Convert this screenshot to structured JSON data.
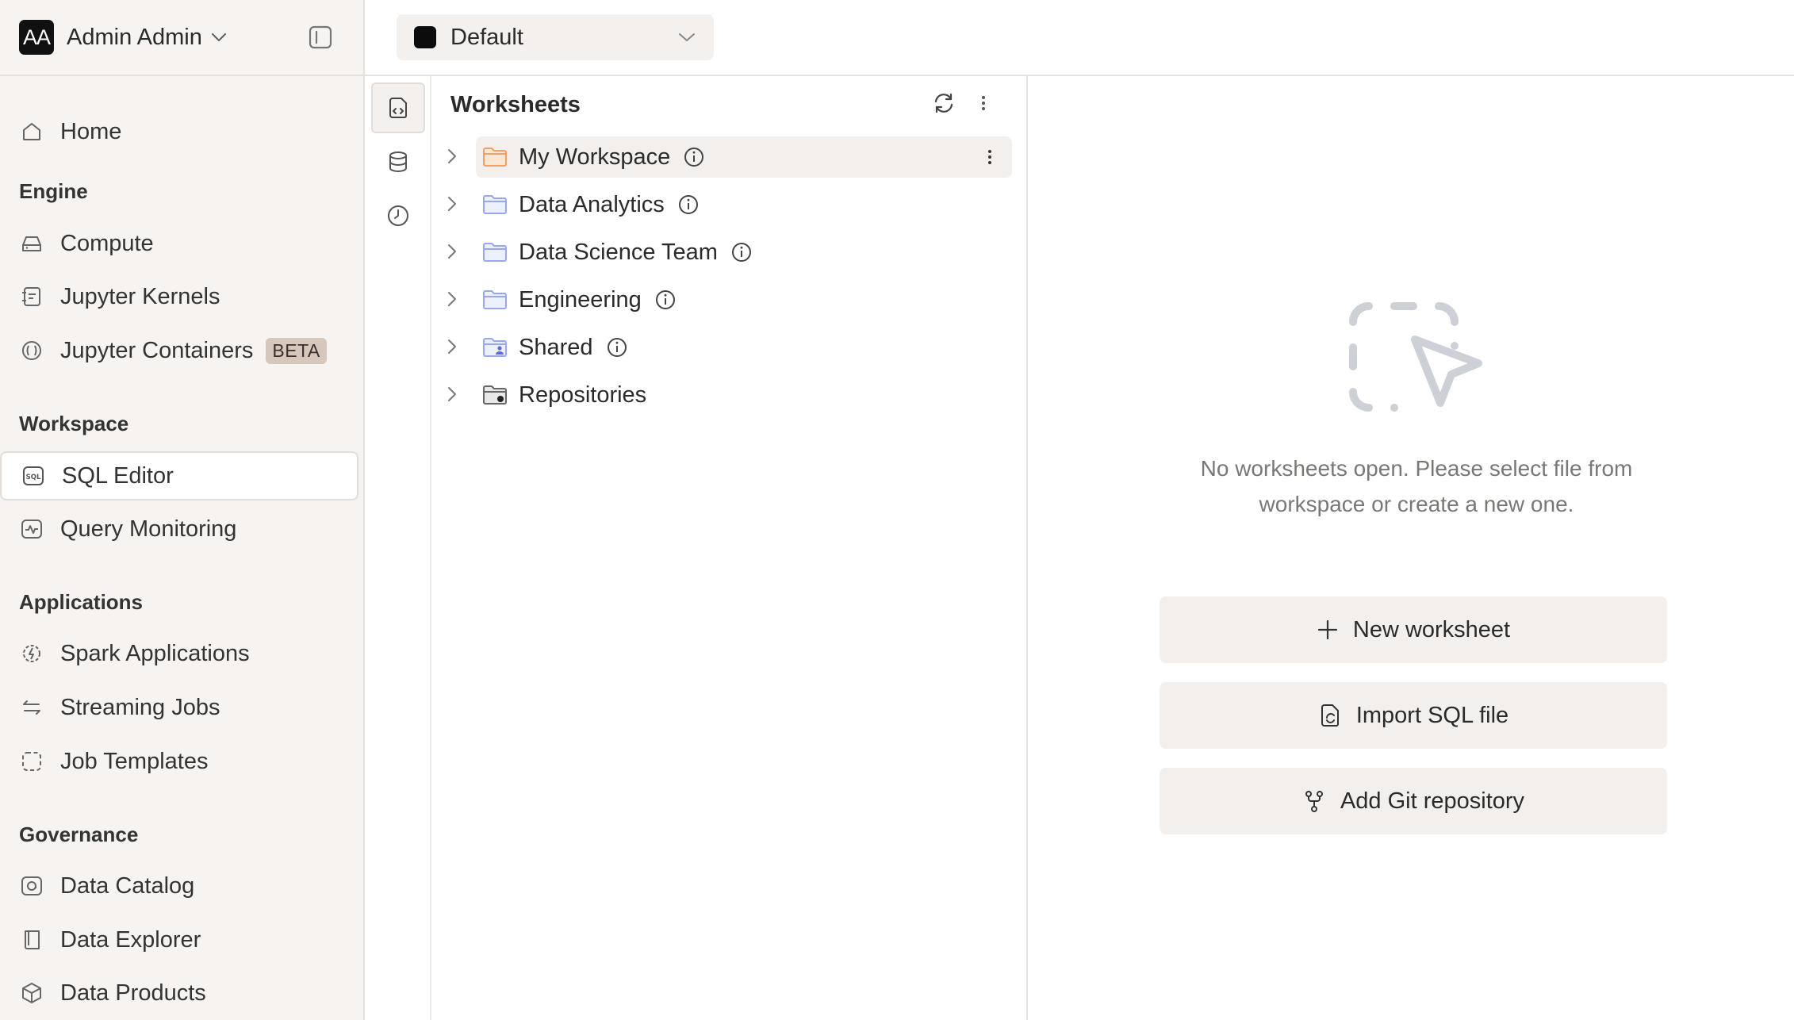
{
  "user": {
    "initials": "AA",
    "name": "Admin Admin"
  },
  "environment": {
    "selected": "Default"
  },
  "sidebar": {
    "home": "Home",
    "engine": {
      "heading": "Engine",
      "items": [
        "Compute",
        "Jupyter Kernels",
        "Jupyter Containers"
      ],
      "badge": "BETA"
    },
    "workspace": {
      "heading": "Workspace",
      "items": [
        "SQL Editor",
        "Query Monitoring"
      ]
    },
    "applications": {
      "heading": "Applications",
      "items": [
        "Spark Applications",
        "Streaming Jobs",
        "Job Templates"
      ]
    },
    "governance": {
      "heading": "Governance",
      "items": [
        "Data Catalog",
        "Data Explorer",
        "Data Products"
      ]
    },
    "active_item": "SQL Editor"
  },
  "worksheets": {
    "title": "Worksheets",
    "folders": [
      {
        "name": "My Workspace",
        "icon": "folder-orange-icon",
        "info": true,
        "selected": true
      },
      {
        "name": "Data Analytics",
        "icon": "folder-icon",
        "info": true
      },
      {
        "name": "Data Science Team",
        "icon": "folder-icon",
        "info": true
      },
      {
        "name": "Engineering",
        "icon": "folder-icon",
        "info": true
      },
      {
        "name": "Shared",
        "icon": "shared-folder-icon",
        "info": true
      },
      {
        "name": "Repositories",
        "icon": "repo-folder-icon",
        "info": false
      }
    ]
  },
  "empty_state": {
    "line1": "No worksheets open. Please select file from",
    "line2": "workspace or create a new one.",
    "buttons": {
      "new_worksheet": "New worksheet",
      "import_sql": "Import SQL file",
      "add_git": "Add Git repository"
    }
  },
  "colors": {
    "sidebar_bg": "#f6f3f0",
    "button_bg": "#f3efec",
    "folder_accent": "#f0a068",
    "folder_default": "#9aa7e8",
    "badge_bg": "#d6c7bd"
  }
}
